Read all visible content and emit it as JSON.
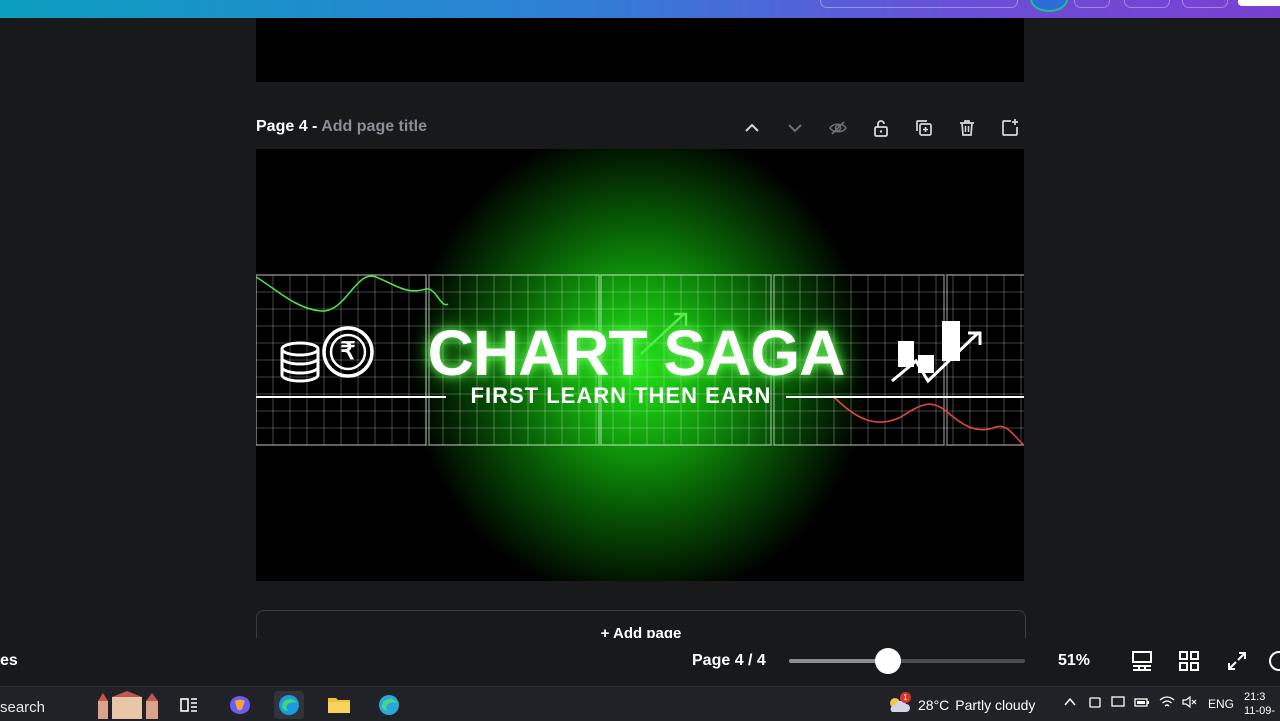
{
  "page": {
    "label": "Page 4 -",
    "title_placeholder": "Add page title"
  },
  "page_actions": [
    {
      "name": "move-up",
      "icon": "chevron-up-icon"
    },
    {
      "name": "move-down",
      "icon": "chevron-down-icon"
    },
    {
      "name": "hide-page",
      "icon": "eye-off-icon"
    },
    {
      "name": "lock-page",
      "icon": "lock-icon"
    },
    {
      "name": "duplicate-page",
      "icon": "duplicate-icon"
    },
    {
      "name": "delete-page",
      "icon": "trash-icon"
    },
    {
      "name": "add-page",
      "icon": "add-page-icon"
    }
  ],
  "design": {
    "brand_name": "CHART SAGA",
    "tagline": "FIRST LEARN THEN EARN",
    "currency_symbol": "₹",
    "glow_color": "#25e61b"
  },
  "add_page_label": "+ Add page",
  "footer": {
    "left_text": "es",
    "page_indicator": "Page 4 / 4",
    "zoom_label": "51%",
    "zoom_fraction": 0.42
  },
  "taskbar": {
    "search_text": "search",
    "weather_temp": "28°C",
    "weather_desc": "Partly cloudy",
    "weather_badge": "1",
    "lang": "ENG",
    "time": "21:3",
    "date": "11-09-"
  },
  "colors": {
    "accent": "#2b6cd8",
    "background": "#18191b"
  }
}
